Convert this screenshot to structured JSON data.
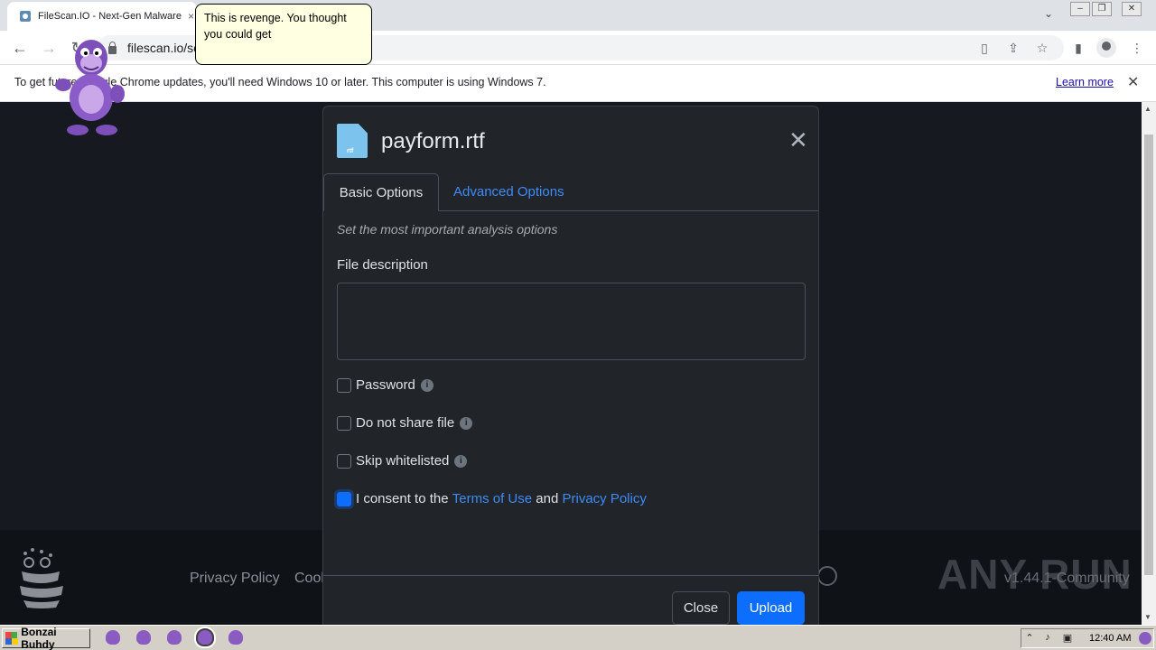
{
  "browser": {
    "tab_title": "FileScan.IO - Next-Gen Malware A",
    "url": "filescan.io/sc",
    "close_tab": "×"
  },
  "infobar": {
    "message": "To get future Google Chrome updates, you'll need Windows 10 or later. This computer is using Windows 7.",
    "learn_more": "Learn more"
  },
  "bonzi": {
    "speech": "This is revenge. You thought you could get"
  },
  "modal": {
    "filename": "payform.rtf",
    "file_ext": "rtf",
    "tabs": [
      "Basic Options",
      "Advanced Options"
    ],
    "subtitle": "Set the most important analysis options",
    "description_label": "File description",
    "description_value": "",
    "options": [
      {
        "label": "Password",
        "checked": false,
        "info": true
      },
      {
        "label": "Do not share file",
        "checked": false,
        "info": true
      },
      {
        "label": "Skip whitelisted",
        "checked": false,
        "info": true
      }
    ],
    "consent": {
      "prefix": "I consent to the",
      "terms": "Terms of Use",
      "and": "and",
      "privacy": "Privacy Policy",
      "checked": true
    },
    "close_button": "Close",
    "upload_button": "Upload"
  },
  "footer": {
    "links": [
      "Privacy Policy",
      "Cookie"
    ],
    "version": "v1.44.1-Community",
    "watermark": "ANY RUN"
  },
  "taskbar": {
    "start_label": "Bonzai Buhdy",
    "clock": "12:40 AM"
  },
  "colors": {
    "modal_bg": "#212529",
    "accent": "#0d6efd",
    "link": "#3d8bfd"
  }
}
